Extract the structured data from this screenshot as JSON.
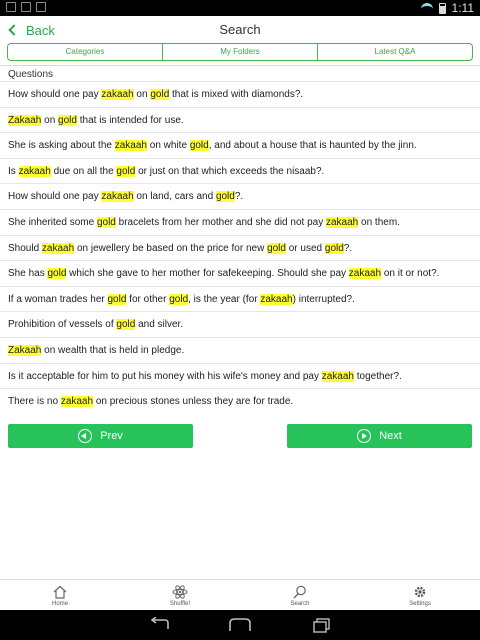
{
  "status_bar": {
    "time": "1:11",
    "icons": [
      "gmail-icon",
      "image-icon",
      "download-icon",
      "wifi-icon",
      "battery-icon"
    ]
  },
  "action_bar": {
    "back_label": "Back",
    "title": "Search"
  },
  "tabs": [
    {
      "label": "Categories"
    },
    {
      "label": "My Folders"
    },
    {
      "label": "Latest Q&A"
    }
  ],
  "section_title": "Questions",
  "highlight_color": "#ffff33",
  "accent_color": "#27c25a",
  "questions": [
    [
      {
        "t": "How should one pay "
      },
      {
        "t": "zakaah",
        "h": true
      },
      {
        "t": " on "
      },
      {
        "t": "gold",
        "h": true
      },
      {
        "t": " that is mixed with diamonds?."
      }
    ],
    [
      {
        "t": "Zakaah",
        "h": true
      },
      {
        "t": " on "
      },
      {
        "t": "gold",
        "h": true
      },
      {
        "t": " that is intended for use."
      }
    ],
    [
      {
        "t": "She is asking about the "
      },
      {
        "t": "zakaah",
        "h": true
      },
      {
        "t": " on white "
      },
      {
        "t": "gold",
        "h": true
      },
      {
        "t": ", and about a house that is haunted by the jinn."
      }
    ],
    [
      {
        "t": "Is "
      },
      {
        "t": "zakaah",
        "h": true
      },
      {
        "t": " due on all the "
      },
      {
        "t": "gold",
        "h": true
      },
      {
        "t": " or just on that which exceeds the nisaab?."
      }
    ],
    [
      {
        "t": "How should one pay "
      },
      {
        "t": "zakaah",
        "h": true
      },
      {
        "t": " on land, cars and "
      },
      {
        "t": "gold",
        "h": true
      },
      {
        "t": "?."
      }
    ],
    [
      {
        "t": "She inherited some "
      },
      {
        "t": "gold",
        "h": true
      },
      {
        "t": " bracelets from her mother and she did not pay "
      },
      {
        "t": "zakaah",
        "h": true
      },
      {
        "t": " on them."
      }
    ],
    [
      {
        "t": "Should "
      },
      {
        "t": "zakaah",
        "h": true
      },
      {
        "t": " on jewellery be based on the price for new "
      },
      {
        "t": "gold",
        "h": true
      },
      {
        "t": " or used "
      },
      {
        "t": "gold",
        "h": true
      },
      {
        "t": "?."
      }
    ],
    [
      {
        "t": "She has "
      },
      {
        "t": "gold",
        "h": true
      },
      {
        "t": " which she gave to her mother for safekeeping. Should she pay "
      },
      {
        "t": "zakaah",
        "h": true
      },
      {
        "t": " on it or not?."
      }
    ],
    [
      {
        "t": "If a woman trades her "
      },
      {
        "t": "gold",
        "h": true
      },
      {
        "t": " for other "
      },
      {
        "t": "gold",
        "h": true
      },
      {
        "t": ", is the year (for "
      },
      {
        "t": "zakaah",
        "h": true
      },
      {
        "t": ") interrupted?."
      }
    ],
    [
      {
        "t": "Prohibition of vessels of "
      },
      {
        "t": "gold",
        "h": true
      },
      {
        "t": " and silver."
      }
    ],
    [
      {
        "t": "Zakaah",
        "h": true
      },
      {
        "t": " on wealth that is held in pledge."
      }
    ],
    [
      {
        "t": "Is it acceptable for him to put his money with his wife's money and pay "
      },
      {
        "t": "zakaah",
        "h": true
      },
      {
        "t": " together?."
      }
    ],
    [
      {
        "t": "There is no "
      },
      {
        "t": "zakaah",
        "h": true
      },
      {
        "t": " on precious stones unless they are for trade."
      }
    ]
  ],
  "buttons": {
    "prev_label": "Prev",
    "next_label": "Next"
  },
  "bottom_nav": [
    {
      "label": "Home",
      "icon": "home-icon"
    },
    {
      "label": "Shuffle!",
      "icon": "atom-icon"
    },
    {
      "label": "Search",
      "icon": "search-icon"
    },
    {
      "label": "Settings",
      "icon": "gear-icon"
    }
  ]
}
